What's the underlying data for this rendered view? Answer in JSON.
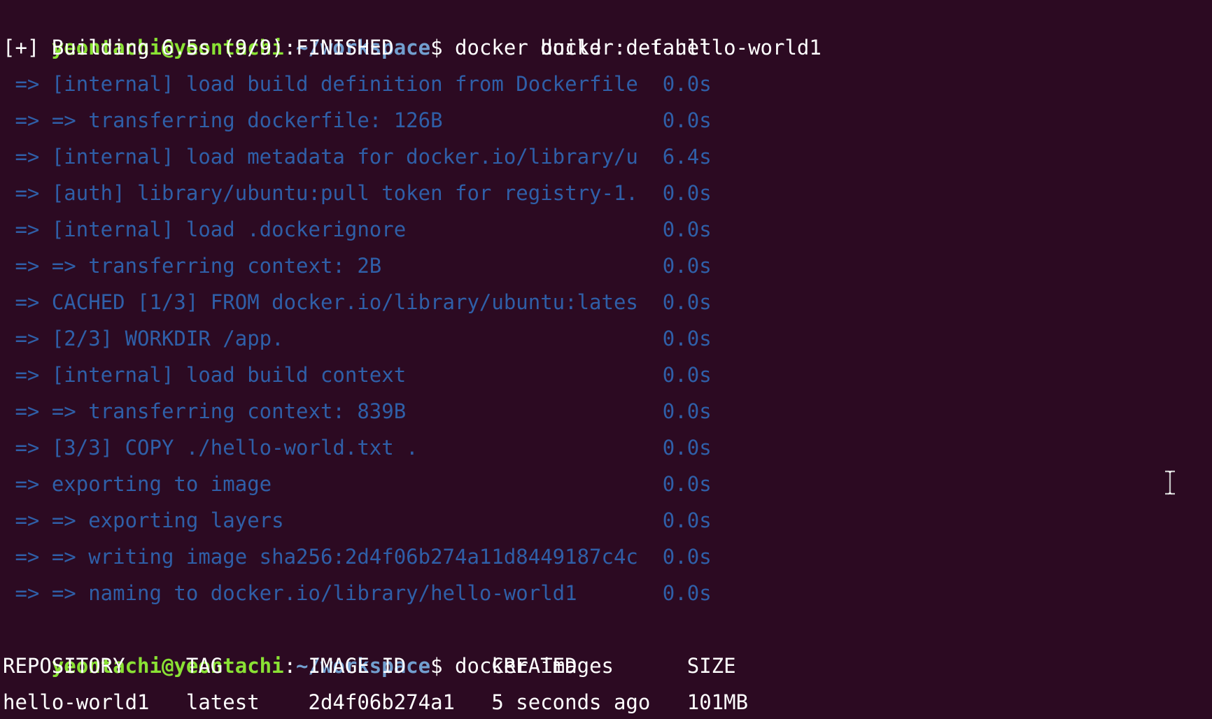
{
  "prompt": {
    "user": "yeontachi@yeontachi",
    "colon": ":",
    "path": "~/workspace",
    "dollar": "$"
  },
  "commands": {
    "build": " docker build . -t hello-world1",
    "images": " docker images"
  },
  "build_header": "[+] Building 6.5s (9/9) FINISHED            docker:default",
  "build_steps": [
    " => [internal] load build definition from Dockerfile  0.0s",
    " => => transferring dockerfile: 126B                  0.0s",
    " => [internal] load metadata for docker.io/library/u  6.4s",
    " => [auth] library/ubuntu:pull token for registry-1.  0.0s",
    " => [internal] load .dockerignore                     0.0s",
    " => => transferring context: 2B                       0.0s",
    " => CACHED [1/3] FROM docker.io/library/ubuntu:lates  0.0s",
    " => [2/3] WORKDIR /app.                               0.0s",
    " => [internal] load build context                     0.0s",
    " => => transferring context: 839B                     0.0s",
    " => [3/3] COPY ./hello-world.txt .                    0.0s",
    " => exporting to image                                0.0s",
    " => => exporting layers                               0.0s",
    " => => writing image sha256:2d4f06b274a11d8449187c4c  0.0s",
    " => => naming to docker.io/library/hello-world1       0.0s"
  ],
  "images_table": {
    "header": "REPOSITORY     TAG       IMAGE ID       CREATED         SIZE",
    "rows": [
      "hello-world1   latest    2d4f06b274a1   5 seconds ago   101MB"
    ]
  },
  "colors": {
    "background": "#2c0a22",
    "prompt_user": "#8ae234",
    "prompt_path": "#729fcf",
    "build_step": "#2f5fa8"
  },
  "icons": {
    "cursor": "text-cursor-ibeam-icon"
  }
}
